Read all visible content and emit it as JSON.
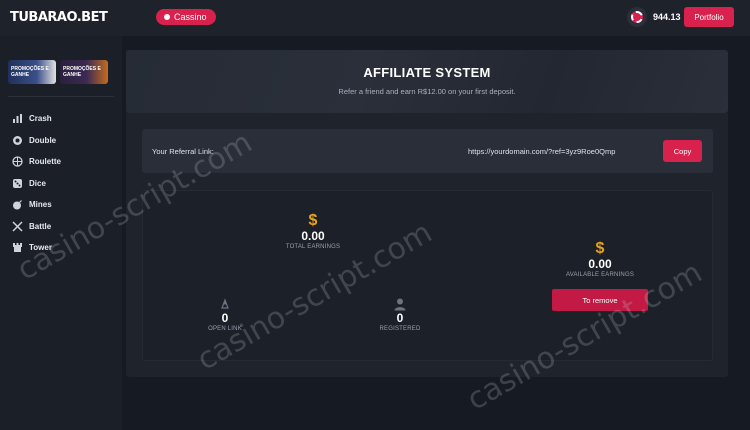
{
  "header": {
    "logo": "TUBARAO.BET",
    "cassino_label": "Cassino",
    "balance": "944.13",
    "portfolio_label": "Portfolio"
  },
  "sidebar": {
    "promos": [
      {
        "text": "PROMOÇÕES E GANHE"
      },
      {
        "text": "PROMOÇÕES E GANHE"
      }
    ],
    "items": [
      {
        "label": "Crash",
        "icon": "chart-icon"
      },
      {
        "label": "Double",
        "icon": "circle-icon"
      },
      {
        "label": "Roulette",
        "icon": "roulette-icon"
      },
      {
        "label": "Dice",
        "icon": "dice-icon"
      },
      {
        "label": "Mines",
        "icon": "bomb-icon"
      },
      {
        "label": "Battle",
        "icon": "swords-icon"
      },
      {
        "label": "Tower",
        "icon": "tower-icon"
      }
    ]
  },
  "affiliate": {
    "title": "AFFILIATE SYSTEM",
    "subtitle": "Refer a friend and earn R$12.00 on your first deposit.",
    "ref_label": "Your Referral Link:",
    "ref_link": "https://yourdomain.com/?ref=3yz9Roe0Qmp",
    "copy_label": "Copy",
    "stats": {
      "total_earnings": {
        "value": "0.00",
        "label": "TOTAL EARNINGS"
      },
      "available_earnings": {
        "value": "0.00",
        "label": "AVAILABLE EARNINGS"
      },
      "remove_label": "To remove",
      "open_link": {
        "value": "0",
        "label": "OPEN LINK"
      },
      "registered": {
        "value": "0",
        "label": "REGISTERED"
      }
    }
  },
  "watermark": "casino-script.com",
  "colors": {
    "accent": "#d9214e",
    "dollar": "#e8a21c",
    "background": "#161a22"
  }
}
